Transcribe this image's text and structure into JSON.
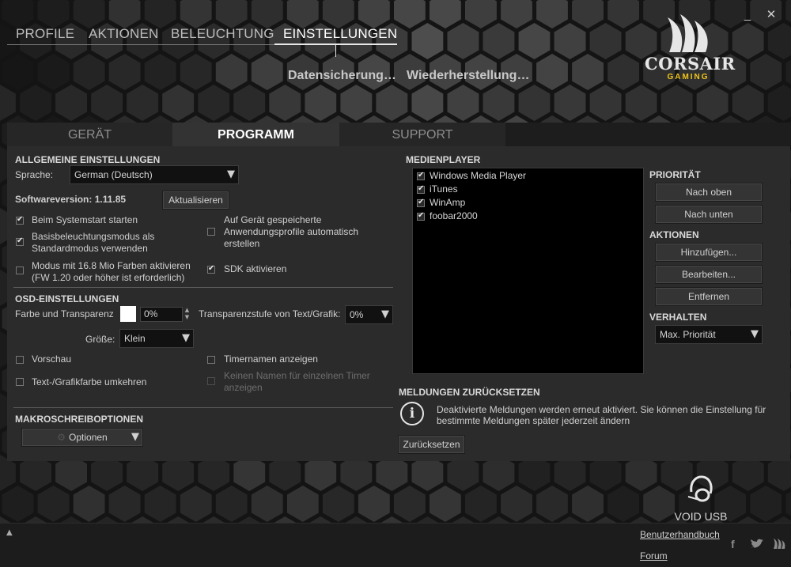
{
  "window": {
    "minimize": "_",
    "close": "✕"
  },
  "nav": {
    "items": [
      "PROFILE",
      "AKTIONEN",
      "BELEUCHTUNG",
      "EINSTELLUNGEN"
    ],
    "sub": [
      "Datensicherung…",
      "Wiederherstellung…"
    ]
  },
  "brand": {
    "name": "CORSAIR",
    "tagline": "GAMING",
    "accent": "#f0c419"
  },
  "tabs": [
    "GERÄT",
    "PROGRAMM",
    "SUPPORT"
  ],
  "general": {
    "title": "ALLGEMEINE EINSTELLUNGEN",
    "language_label": "Sprache:",
    "language_value": "German (Deutsch)",
    "version_label": "Softwareversion: 1.11.85",
    "update_button": "Aktualisieren",
    "options": [
      {
        "label": "Beim Systemstart starten",
        "checked": true
      },
      {
        "label": "Basisbeleuchtungsmodus als Standardmodus verwenden",
        "line1": "Basisbeleuchtungsmodus als",
        "line2": "Standardmodus verwenden",
        "checked": true
      },
      {
        "line1": "Modus mit 16.8 Mio Farben aktivieren",
        "line2": "(FW 1.20 oder höher ist erforderlich)",
        "checked": false
      },
      {
        "line1": "Auf Gerät gespeicherte",
        "line2": "Anwendungsprofile automatisch",
        "line3": "erstellen",
        "checked": false
      },
      {
        "label": "SDK aktivieren",
        "checked": true
      }
    ]
  },
  "osd": {
    "title": "OSD-EINSTELLUNGEN",
    "color_label": "Farbe und Transparenz",
    "transparency_value": "0%",
    "text_transparency_label": "Transparenzstufe von Text/Grafik:",
    "text_transparency_value": "0%",
    "size_label": "Größe:",
    "size_value": "Klein",
    "options": [
      {
        "label": "Vorschau",
        "checked": false
      },
      {
        "label": "Timernamen anzeigen",
        "checked": false
      },
      {
        "label": "Text-/Grafikfarbe umkehren",
        "checked": false
      },
      {
        "line1": "Keinen Namen für einzelnen Timer",
        "line2": "anzeigen",
        "checked": false,
        "disabled": true
      }
    ]
  },
  "macro": {
    "title": "MAKROSCHREIBOPTIONEN",
    "options_button": "Optionen"
  },
  "media": {
    "title": "MEDIENPLAYER",
    "players": [
      {
        "label": "Windows Media Player",
        "checked": true
      },
      {
        "label": "iTunes",
        "checked": true
      },
      {
        "label": "WinAmp",
        "checked": true
      },
      {
        "label": "foobar2000",
        "checked": true
      }
    ],
    "priority_title": "PRIORITÄT",
    "move_up": "Nach oben",
    "move_down": "Nach unten",
    "actions_title": "AKTIONEN",
    "add": "Hinzufügen...",
    "edit": "Bearbeiten...",
    "remove": "Entfernen",
    "behavior_title": "VERHALTEN",
    "behavior_value": "Max. Priorität"
  },
  "messages": {
    "title": "MELDUNGEN ZURÜCKSETZEN",
    "line1": "Deaktivierte Meldungen werden erneut aktiviert. Sie können die Einstellung für",
    "line2": "bestimmte Meldungen später jederzeit ändern",
    "reset_button": "Zurücksetzen"
  },
  "device": {
    "name": "VOID USB"
  },
  "footer": {
    "manual": "Benutzerhandbuch",
    "forum": "Forum",
    "expand": "▲",
    "social": {
      "facebook": "f",
      "twitter": "twitter-icon",
      "corsair": "corsair-icon"
    }
  }
}
